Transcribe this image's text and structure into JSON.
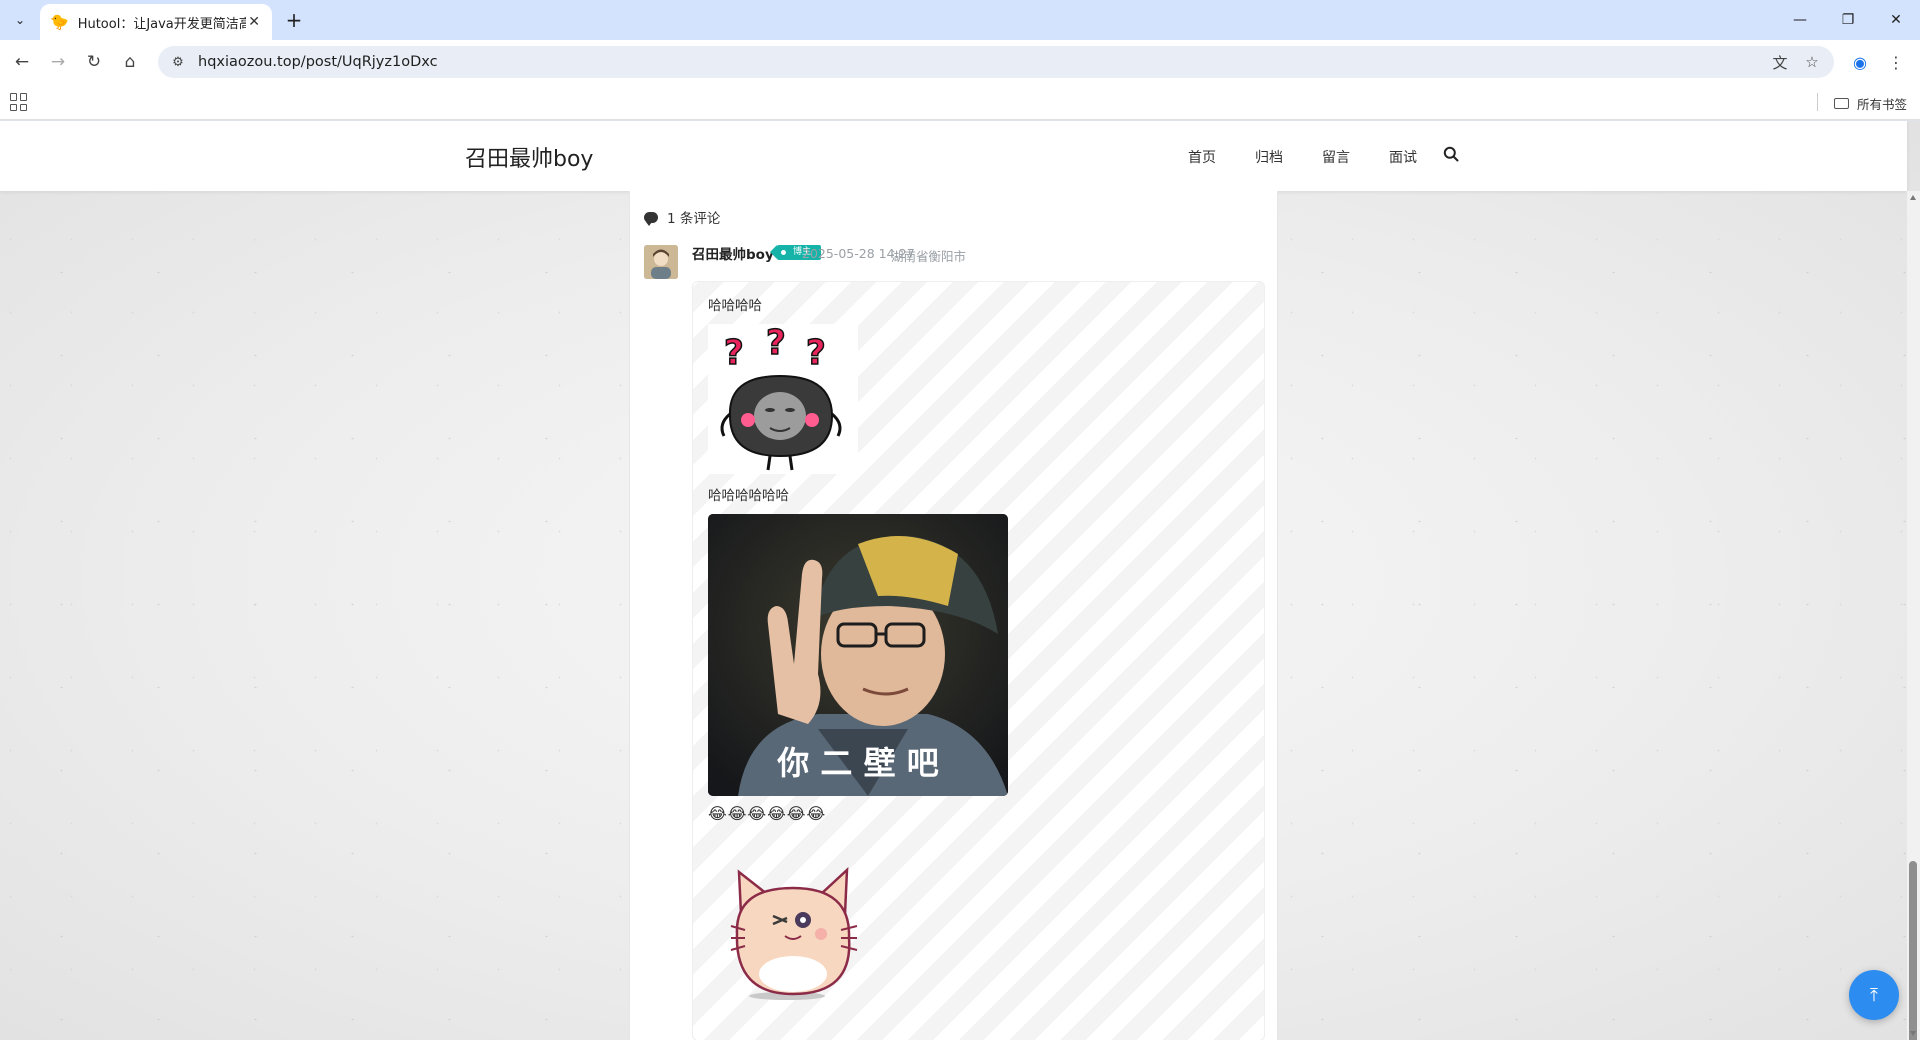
{
  "browser": {
    "tab": {
      "favicon": "🐤",
      "title": "Hutool：让Java开发更简洁高效",
      "close": "✕"
    },
    "new_tab": "+",
    "tab_menu": "⌄",
    "window": {
      "minimize": "—",
      "restore": "❐",
      "close": "✕"
    },
    "nav": {
      "back": "←",
      "forward": "→",
      "reload": "↻",
      "home": "⌂"
    },
    "url": "hqxiaozou.top/post/UqRjyz1oDxc",
    "site_info": "⚙",
    "translate": "文",
    "bookmark_star": "☆",
    "profile": "◉",
    "more": "⋮",
    "all_bookmarks": "所有书签"
  },
  "site": {
    "brand": "召田最帅boy",
    "menu": [
      "首页",
      "归档",
      "留言",
      "面试"
    ]
  },
  "comments": {
    "count_label": "1 条评论",
    "item": {
      "author": "召田最帅boy",
      "badge": "博主",
      "time": "2025-05-28 14:27",
      "location": "湖南省衡阳市",
      "line1": "哈哈哈哈",
      "line2": "哈哈哈哈哈哈",
      "meme_caption": "你 二 壁 吧",
      "emojis": "😂😂😂😂😂😂"
    }
  },
  "back_to_top": "⤒"
}
